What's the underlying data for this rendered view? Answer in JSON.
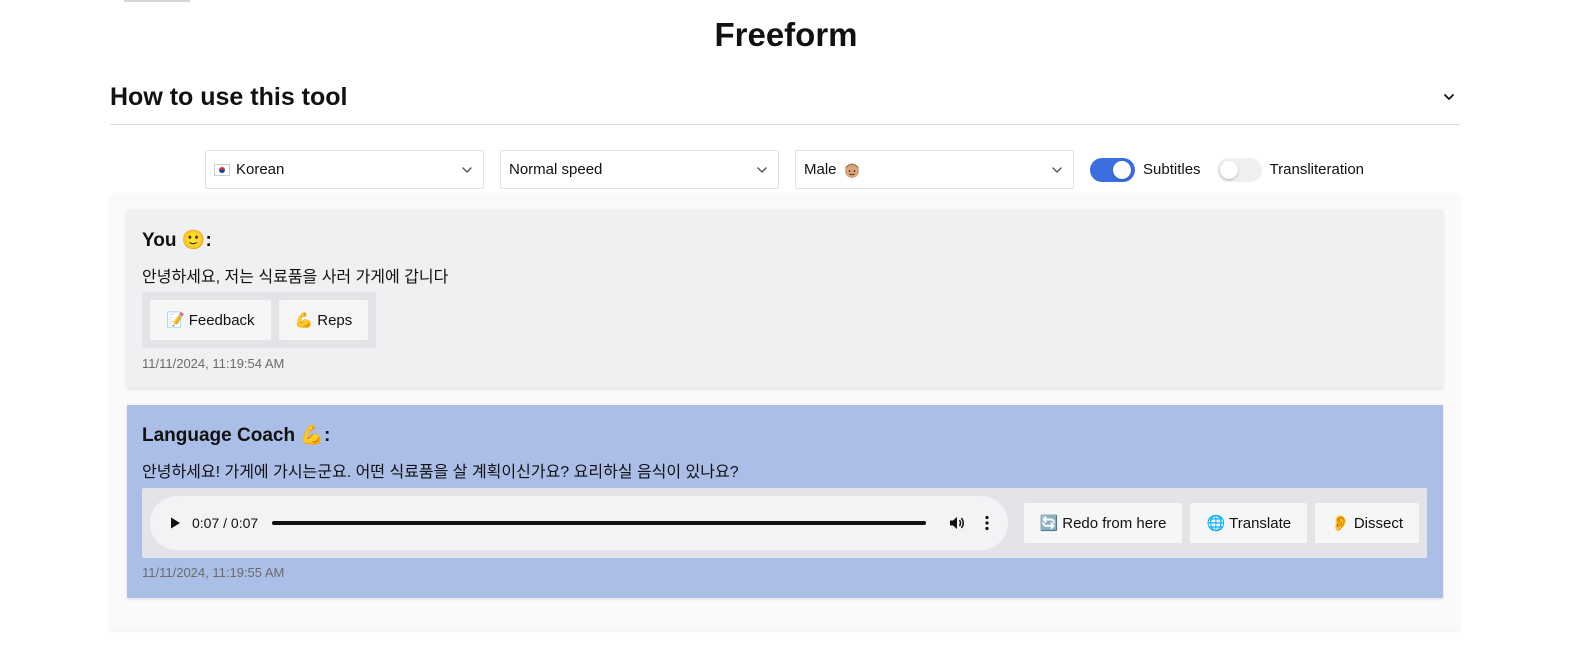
{
  "page": {
    "title": "Freeform"
  },
  "accordion": {
    "title": "How to use this tool"
  },
  "controls": {
    "language": "Korean",
    "speed": "Normal speed",
    "voice": "Male",
    "subtitles": {
      "label": "Subtitles",
      "enabled": true
    },
    "transliteration": {
      "label": "Transliteration",
      "enabled": false
    }
  },
  "messages": [
    {
      "author": "You",
      "author_emoji": "🙂",
      "text": "안녕하세요, 저는 식료품을 사러 가게에 갑니다",
      "buttons": [
        {
          "icon": "📝",
          "label": "Feedback"
        },
        {
          "icon": "💪",
          "label": "Reps"
        }
      ],
      "timestamp": "11/11/2024, 11:19:54 AM"
    },
    {
      "author": "Language Coach",
      "author_emoji": "💪",
      "text": "안녕하세요! 가게에 가시는군요. 어떤 식료품을 살 계획이신가요? 요리하실 음식이 있나요?",
      "audio": {
        "time": "0:07 / 0:07",
        "progress": 1.0
      },
      "buttons": [
        {
          "icon": "🔄",
          "label": "Redo from here"
        },
        {
          "icon": "🌐",
          "label": "Translate"
        },
        {
          "icon": "👂",
          "label": "Dissect"
        }
      ],
      "timestamp": "11/11/2024, 11:19:55 AM"
    }
  ],
  "colors": {
    "toggle_on": "#3b6fe0",
    "coach_bg": "#aabee8",
    "user_bg": "#eff0f2"
  }
}
